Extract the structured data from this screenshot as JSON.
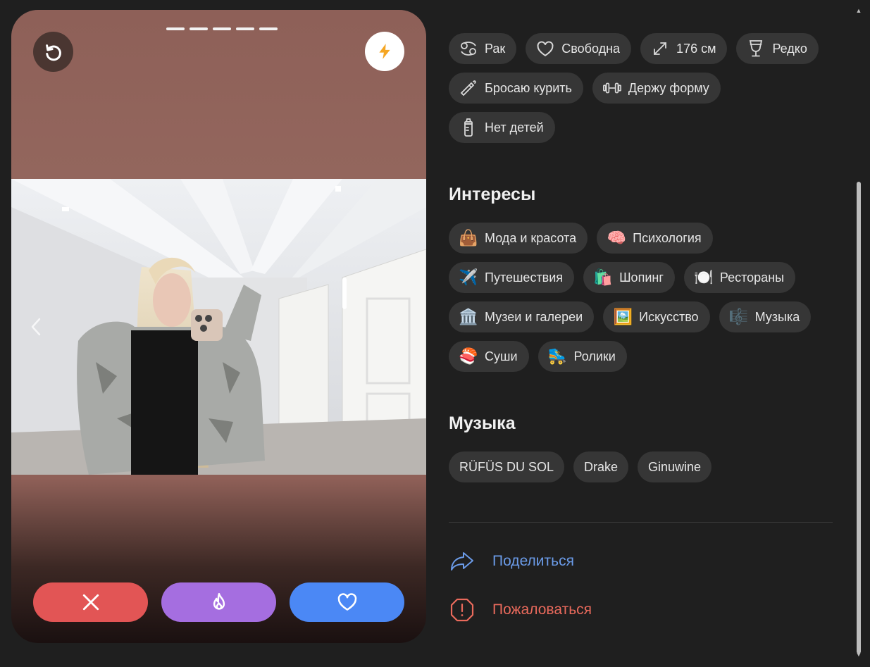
{
  "profile_card": {
    "photos_count": 5,
    "colors": {
      "like": "#4b88f5",
      "dislike": "#e25555",
      "superlike": "#a56ee0",
      "boost": "#f5a623"
    },
    "icons": {
      "undo": "undo-icon",
      "boost": "lightning-icon",
      "prev": "chevron-left-icon",
      "dislike": "close-icon",
      "superlike": "flame-icon",
      "like": "heart-icon"
    }
  },
  "about": {
    "chips": [
      {
        "icon": "cancer-zodiac-icon",
        "label": "Рак"
      },
      {
        "icon": "heart-outline-icon",
        "label": "Свободна"
      },
      {
        "icon": "expand-icon",
        "label": "176 см"
      },
      {
        "icon": "wine-glass-icon",
        "label": "Редко"
      },
      {
        "icon": "cigarette-icon",
        "label": "Бросаю курить"
      },
      {
        "icon": "dumbbell-icon",
        "label": "Держу форму"
      },
      {
        "icon": "baby-bottle-icon",
        "label": "Нет детей"
      }
    ]
  },
  "interests": {
    "title": "Интересы",
    "chips": [
      {
        "emoji": "👜",
        "label": "Мода и красота"
      },
      {
        "emoji": "🧠",
        "label": "Психология"
      },
      {
        "emoji": "✈️",
        "label": "Путешествия"
      },
      {
        "emoji": "🛍️",
        "label": "Шопинг"
      },
      {
        "emoji": "🍽️",
        "label": "Рестораны"
      },
      {
        "emoji": "🏛️",
        "label": "Музеи и галереи"
      },
      {
        "emoji": "🖼️",
        "label": "Искусство"
      },
      {
        "emoji": "🎼",
        "label": "Музыка"
      },
      {
        "emoji": "🍣",
        "label": "Суши"
      },
      {
        "emoji": "🛼",
        "label": "Ролики"
      }
    ]
  },
  "music": {
    "title": "Музыка",
    "artists": [
      "RÜFÜS DU SOL",
      "Drake",
      "Ginuwine"
    ]
  },
  "actions": {
    "share_label": "Поделиться",
    "report_label": "Пожаловаться"
  }
}
